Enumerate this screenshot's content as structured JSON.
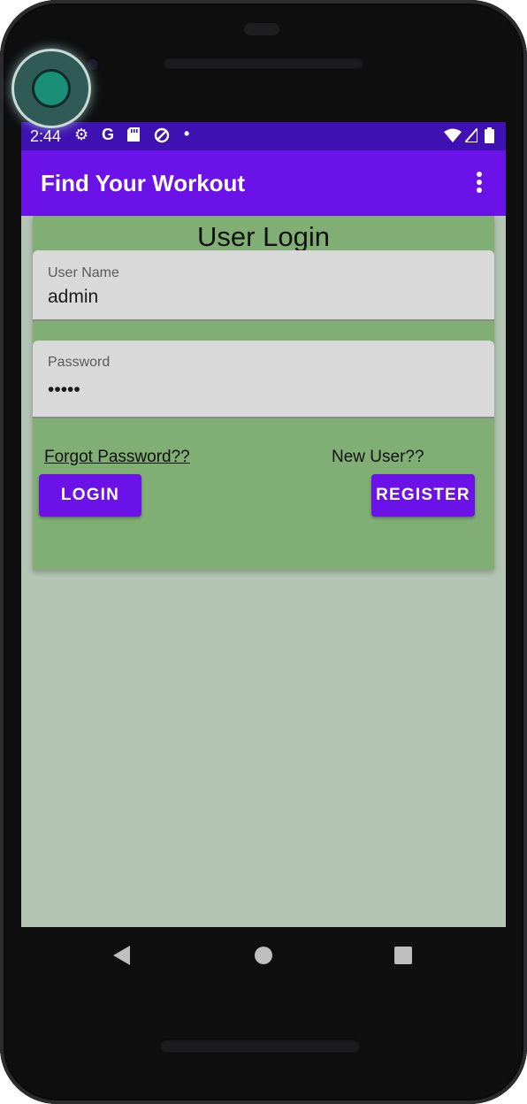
{
  "status_bar": {
    "time": "2:44",
    "icons_left": [
      "settings-icon",
      "google-icon",
      "sd-card-icon",
      "data-saver-icon",
      "notification-dot-icon"
    ],
    "icons_right": [
      "wifi-icon",
      "cell-signal-icon",
      "battery-icon"
    ]
  },
  "app_bar": {
    "title": "Find Your Workout",
    "overflow_icon": "more-vert-icon"
  },
  "login": {
    "title": "User Login",
    "username": {
      "label": "User Name",
      "value": "admin"
    },
    "password": {
      "label": "Password",
      "value": "•••••"
    },
    "forgot_link": "Forgot Password??",
    "new_user_text": "New User??",
    "login_button": "LOGIN",
    "register_button": "REGISTER"
  },
  "nav_bar": {
    "back_icon": "back-triangle-icon",
    "home_icon": "home-circle-icon",
    "recents_icon": "recents-square-icon"
  },
  "colors": {
    "status_bar": "#3f11b2",
    "app_bar": "#6a12e8",
    "card": "#80ae74",
    "screen_bg": "#b4c5b4",
    "button": "#6a12e8"
  }
}
